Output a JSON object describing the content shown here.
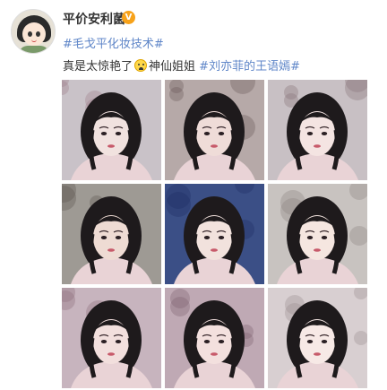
{
  "post": {
    "username": "平价安利菌",
    "verified_badge": "V",
    "topic": "#毛戈平化妆技术#",
    "text_main": "真是太惊艳了",
    "emoji": "smiling-face-icon",
    "text_after_emoji": "神仙姐姐",
    "hashtag": "#刘亦菲的王语嫣#"
  },
  "images": [
    {
      "name": "photo-1",
      "bg": "#c9c2c8",
      "accent": "#9d7f8a",
      "face": "#f1e2df"
    },
    {
      "name": "photo-2",
      "bg": "#b6a9a8",
      "accent": "#6b5a5a",
      "face": "#efdcd8"
    },
    {
      "name": "photo-3",
      "bg": "#c8c0c4",
      "accent": "#867479",
      "face": "#f4e4e2"
    },
    {
      "name": "photo-4",
      "bg": "#9e9a94",
      "accent": "#5b5651",
      "face": "#eedbd3"
    },
    {
      "name": "photo-5",
      "bg": "#3b4f86",
      "accent": "#1f2f63",
      "face": "#f2e2dd"
    },
    {
      "name": "photo-6",
      "bg": "#c8c3c0",
      "accent": "#8d8480",
      "face": "#f5e6e0"
    },
    {
      "name": "photo-7",
      "bg": "#c7b4be",
      "accent": "#8b6e7b",
      "face": "#f2dfdd"
    },
    {
      "name": "photo-8",
      "bg": "#bfa9b4",
      "accent": "#7f6270",
      "face": "#f3e0de"
    },
    {
      "name": "photo-9",
      "bg": "#d8cfd1",
      "accent": "#9b8d90",
      "face": "#f7e9e6"
    }
  ]
}
